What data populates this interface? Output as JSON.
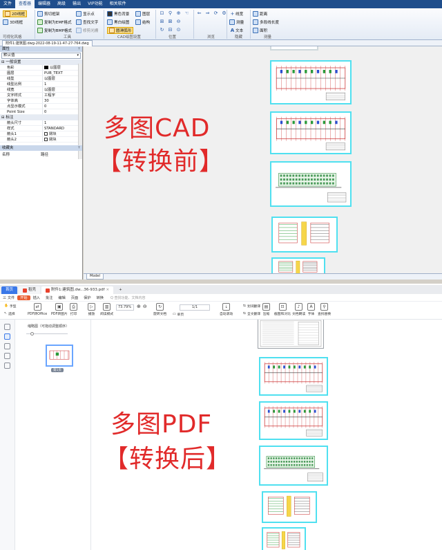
{
  "cad": {
    "menu": [
      "文件",
      "查看器",
      "编辑器",
      "高级",
      "输出",
      "VIP功能",
      "相关软件"
    ],
    "ribbon": {
      "view_2d": "2D线框",
      "view_3d": "3D线框",
      "clip_frame": "剪切框架",
      "copy_emf": "复制为EMF格式",
      "copy_bmp": "复制为BMP格式",
      "show_points": "显示点",
      "find_text": "查找文字",
      "trim_raster": "修剪光栅",
      "black_bg": "黑色背景",
      "black_white": "黑白绘图",
      "smooth_arc": "圆滑弧形",
      "layer": "图层",
      "structure": "结构",
      "line_style": "线宽",
      "measure": "测量",
      "text": "文本",
      "distance": "距离",
      "polyline_len": "多段线长度",
      "area": "面积",
      "group_visual": "可视化风格",
      "group_tools": "工具",
      "group_cad": "CAD绘图设置",
      "group_position": "位置",
      "group_browse": "浏览",
      "group_hide": "隐藏",
      "group_measure": "测量"
    },
    "doc_tab": "附件1:建筑图.dwg-2022-08-19-11-47-27-764.dwg",
    "properties": {
      "title": "属性",
      "combo": "默认值",
      "section_general": "一般设置",
      "rows_general": [
        {
          "k": "色彩",
          "v": "以图层"
        },
        {
          "k": "图层",
          "v": "PUB_TEXT"
        },
        {
          "k": "线型",
          "v": "以图层"
        },
        {
          "k": "线型比例",
          "v": "1"
        },
        {
          "k": "线宽",
          "v": "以图层"
        },
        {
          "k": "文字样式",
          "v": "工程字"
        },
        {
          "k": "字体高",
          "v": "30"
        },
        {
          "k": "点显示模式",
          "v": "0"
        },
        {
          "k": "Point Size",
          "v": "0"
        }
      ],
      "section_dim": "标注",
      "rows_dim": [
        {
          "k": "箭头尺寸",
          "v": "1"
        },
        {
          "k": "样式",
          "v": "STANDARD"
        },
        {
          "k": "箭头1",
          "v": "閉块"
        },
        {
          "k": "箭头2",
          "v": "閉块"
        }
      ]
    },
    "favorites": {
      "title": "收藏夹",
      "col_name": "名称",
      "col_path": "路径"
    },
    "model_tab": "Model",
    "overlay_line1": "多图CAD",
    "overlay_line2": "【转换前】"
  },
  "pdf": {
    "tabs": {
      "home": "首页",
      "shell": "稻壳",
      "doc": "附件1:建筑图.dw...36-933.pdf"
    },
    "menu": [
      "三 文件",
      "开始",
      "插入",
      "批注",
      "编辑",
      "页面",
      "保护",
      "转换"
    ],
    "search_placeholder": "Q 查找功能、文档内容",
    "toolbar": {
      "hand": "手型",
      "select": "选择",
      "pdf_office": "PDF转Office",
      "pdf_image": "PDF转图片",
      "print": "打印",
      "play": "播放",
      "read_mode": "阅读模式",
      "zoom": "73.79%",
      "page": "1/1",
      "rotate": "旋转文档",
      "single": "单页",
      "auto_scroll": "自动滚动",
      "translate": "划词翻译",
      "full_translate": "全文翻译",
      "compress": "压缩",
      "screenshot": "截图和对比",
      "read_aloud": "文档朗读",
      "font": "字体",
      "find": "查找替换"
    },
    "thumbs": {
      "title": "缩略图（可拖动调整顺序）",
      "page_label": "第1页"
    },
    "overlay_line1": "多图PDF",
    "overlay_line2": "【转换后】"
  }
}
